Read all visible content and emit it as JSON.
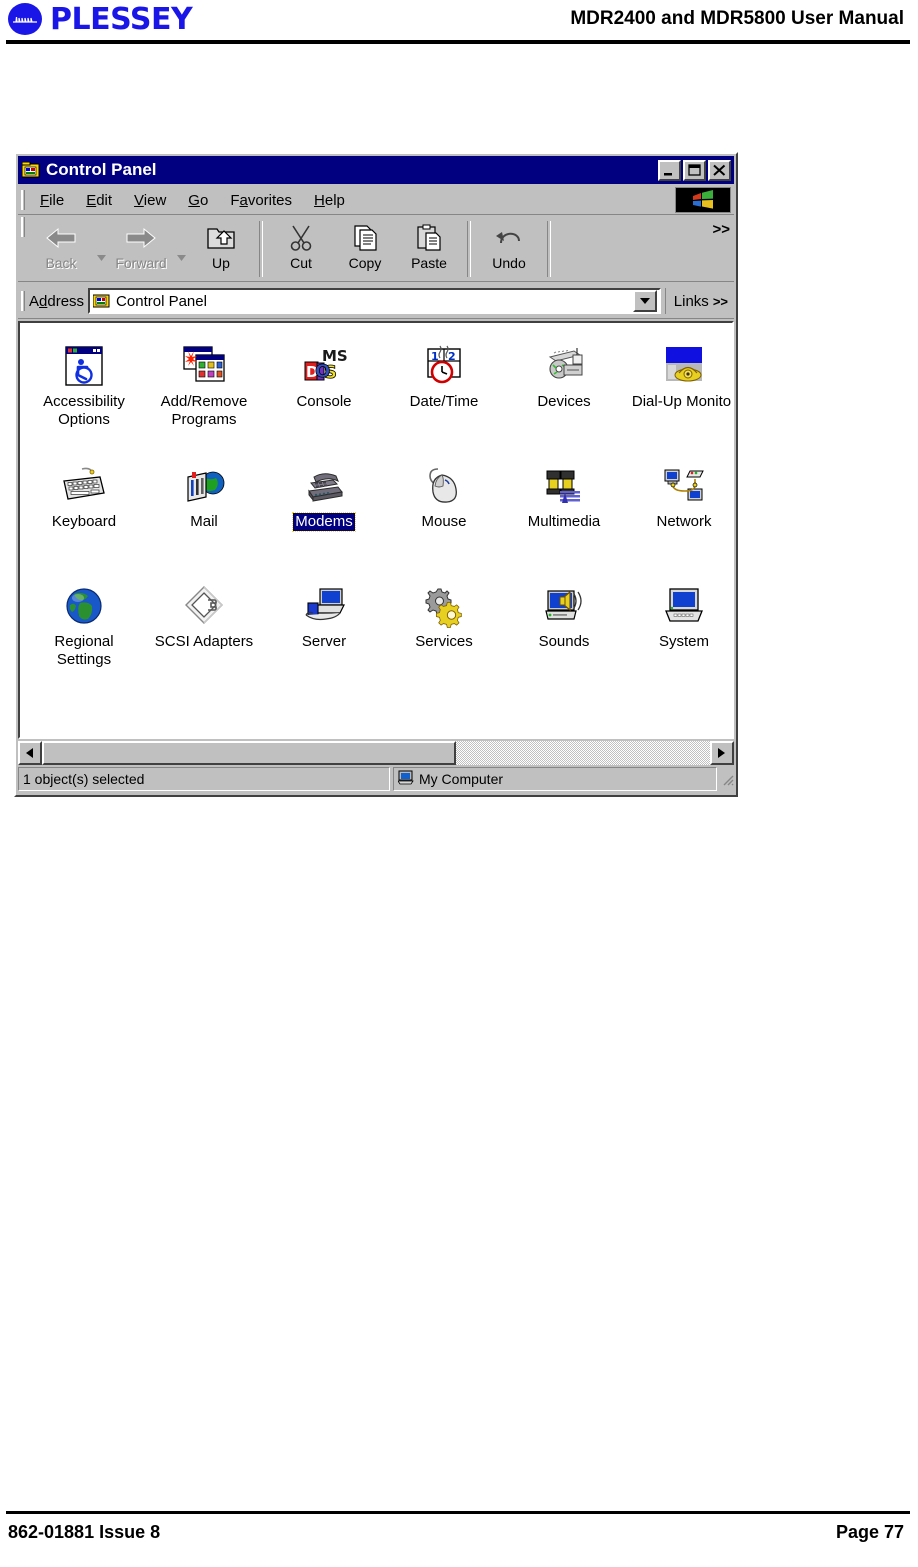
{
  "page": {
    "brand": "PLESSEY",
    "manual_title": "MDR2400 and MDR5800 User Manual",
    "footer_left": "862-01881 Issue 8",
    "footer_right": "Page 77",
    "brand_color": "#1a16e8"
  },
  "window": {
    "title": "Control Panel",
    "title_icon": "control-panel-icon",
    "titlebar_color": "#000080",
    "buttons": {
      "minimize": "minimize-button",
      "maximize": "maximize-button",
      "close": "close-button"
    }
  },
  "menubar": {
    "items": [
      {
        "label": "File",
        "accel": "F"
      },
      {
        "label": "Edit",
        "accel": "E"
      },
      {
        "label": "View",
        "accel": "V"
      },
      {
        "label": "Go",
        "accel": "G"
      },
      {
        "label": "Favorites",
        "accel": "a"
      },
      {
        "label": "Help",
        "accel": "H"
      }
    ]
  },
  "toolbar": {
    "back_label": "Back",
    "forward_label": "Forward",
    "up_label": "Up",
    "cut_label": "Cut",
    "copy_label": "Copy",
    "paste_label": "Paste",
    "undo_label": "Undo",
    "overflow_chevron": ">>"
  },
  "addressbar": {
    "label": "Address",
    "value": "Control Panel",
    "icon": "control-panel-icon",
    "links_label": "Links",
    "links_chevron": ">>"
  },
  "items": [
    {
      "label": "Accessibility Options",
      "icon": "accessibility-icon",
      "selected": false
    },
    {
      "label": "Add/Remove Programs",
      "icon": "add-remove-programs-icon",
      "selected": false
    },
    {
      "label": "Console",
      "icon": "ms-dos-console-icon",
      "selected": false
    },
    {
      "label": "Date/Time",
      "icon": "date-time-icon",
      "selected": false
    },
    {
      "label": "Devices",
      "icon": "devices-icon",
      "selected": false
    },
    {
      "label": "Dial-Up Monitor",
      "icon": "dial-up-monitor-icon",
      "selected": false
    },
    {
      "label": "Keyboard",
      "icon": "keyboard-icon",
      "selected": false
    },
    {
      "label": "Mail",
      "icon": "mail-icon",
      "selected": false
    },
    {
      "label": "Modems",
      "icon": "modems-icon",
      "selected": true
    },
    {
      "label": "Mouse",
      "icon": "mouse-icon",
      "selected": false
    },
    {
      "label": "Multimedia",
      "icon": "multimedia-icon",
      "selected": false
    },
    {
      "label": "Network",
      "icon": "network-icon",
      "selected": false
    },
    {
      "label": "Regional Settings",
      "icon": "regional-settings-icon",
      "selected": false
    },
    {
      "label": "SCSI Adapters",
      "icon": "scsi-adapters-icon",
      "selected": false
    },
    {
      "label": "Server",
      "icon": "server-icon",
      "selected": false
    },
    {
      "label": "Services",
      "icon": "services-icon",
      "selected": false
    },
    {
      "label": "Sounds",
      "icon": "sounds-icon",
      "selected": false
    },
    {
      "label": "System",
      "icon": "system-icon",
      "selected": false
    }
  ],
  "statusbar": {
    "selection_text": "1 object(s) selected",
    "zone_text": "My Computer",
    "zone_icon": "my-computer-icon"
  }
}
